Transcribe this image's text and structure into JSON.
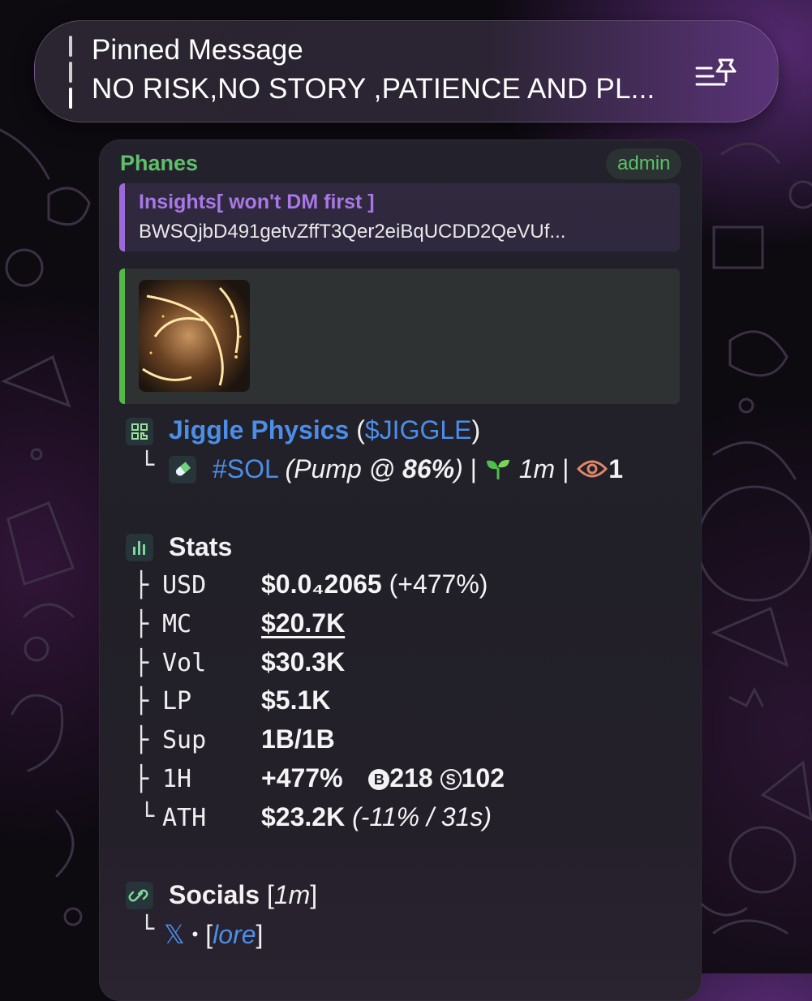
{
  "pinned": {
    "title": "Pinned Message",
    "text": "NO RISK,NO STORY ,PATIENCE AND PL..."
  },
  "message": {
    "sender": "Phanes",
    "badge": "admin",
    "reply": {
      "name": "Insights[ won't DM first ]",
      "text": "BWSQjbD491getvZffT3Qer2eiBqUCDD2QeVUf..."
    },
    "token": {
      "name": "Jiggle Physics",
      "open": "(",
      "ticker": "$JIGGLE",
      "close": ")",
      "chain": "#SOL",
      "pump_prefix": "(Pump @ ",
      "pump_pct": "86%",
      "pump_suffix": ")",
      "sep": "|",
      "age": "1m",
      "views": "1"
    },
    "stats": {
      "heading": "Stats",
      "rows": [
        {
          "key": "USD",
          "value": "$0.0₄2065",
          "extra": "(+477%)"
        },
        {
          "key": "MC",
          "value": "$20.7K"
        },
        {
          "key": "Vol",
          "value": "$30.3K"
        },
        {
          "key": "LP",
          "value": "$5.1K"
        },
        {
          "key": "Sup",
          "value": "1B/1B"
        },
        {
          "key": "1H",
          "value": "+477%",
          "buys_label": "B",
          "buys": "218",
          "sells_label": "S",
          "sells": "102"
        },
        {
          "key": "ATH",
          "value": "$23.2K",
          "extra": "(-11% / 31s)"
        }
      ]
    },
    "socials": {
      "heading": "Socials",
      "age": "1m",
      "x_label": "𝕏",
      "dot": "•",
      "lore": "lore"
    }
  },
  "colors": {
    "sender_green": "#5fbf6a",
    "reply_purple": "#a879e6",
    "link_blue": "#4c8ee6",
    "preview_bar": "#55b64a"
  }
}
